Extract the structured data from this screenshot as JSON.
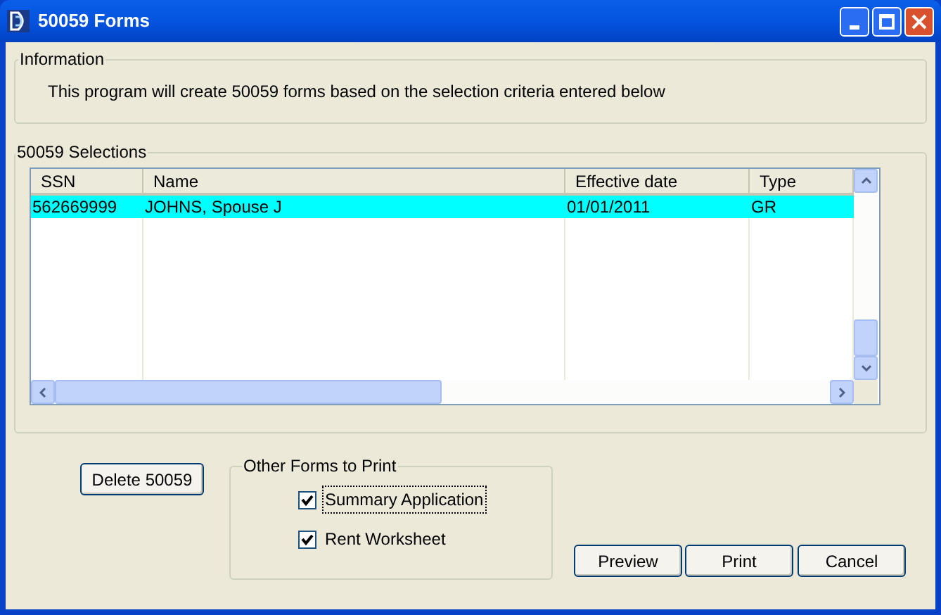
{
  "window": {
    "title": "50059 Forms"
  },
  "information": {
    "title": "Information",
    "text": "This program will create 50059 forms based on the selection criteria entered below"
  },
  "selections": {
    "title": "50059 Selections",
    "columns": [
      "SSN",
      "Name",
      "Effective date",
      "Type"
    ],
    "rows": [
      {
        "cells": [
          "562669999",
          "JOHNS, Spouse J",
          "01/01/2011",
          "GR"
        ],
        "selected": true
      }
    ]
  },
  "delete_button": "Delete 50059",
  "other_forms": {
    "title": "Other Forms to Print",
    "options": [
      {
        "label": "Summary Application",
        "checked": true,
        "focused": true
      },
      {
        "label": "Rent Worksheet",
        "checked": true,
        "focused": false
      }
    ]
  },
  "buttons": [
    "Preview",
    "Print",
    "Cancel"
  ]
}
